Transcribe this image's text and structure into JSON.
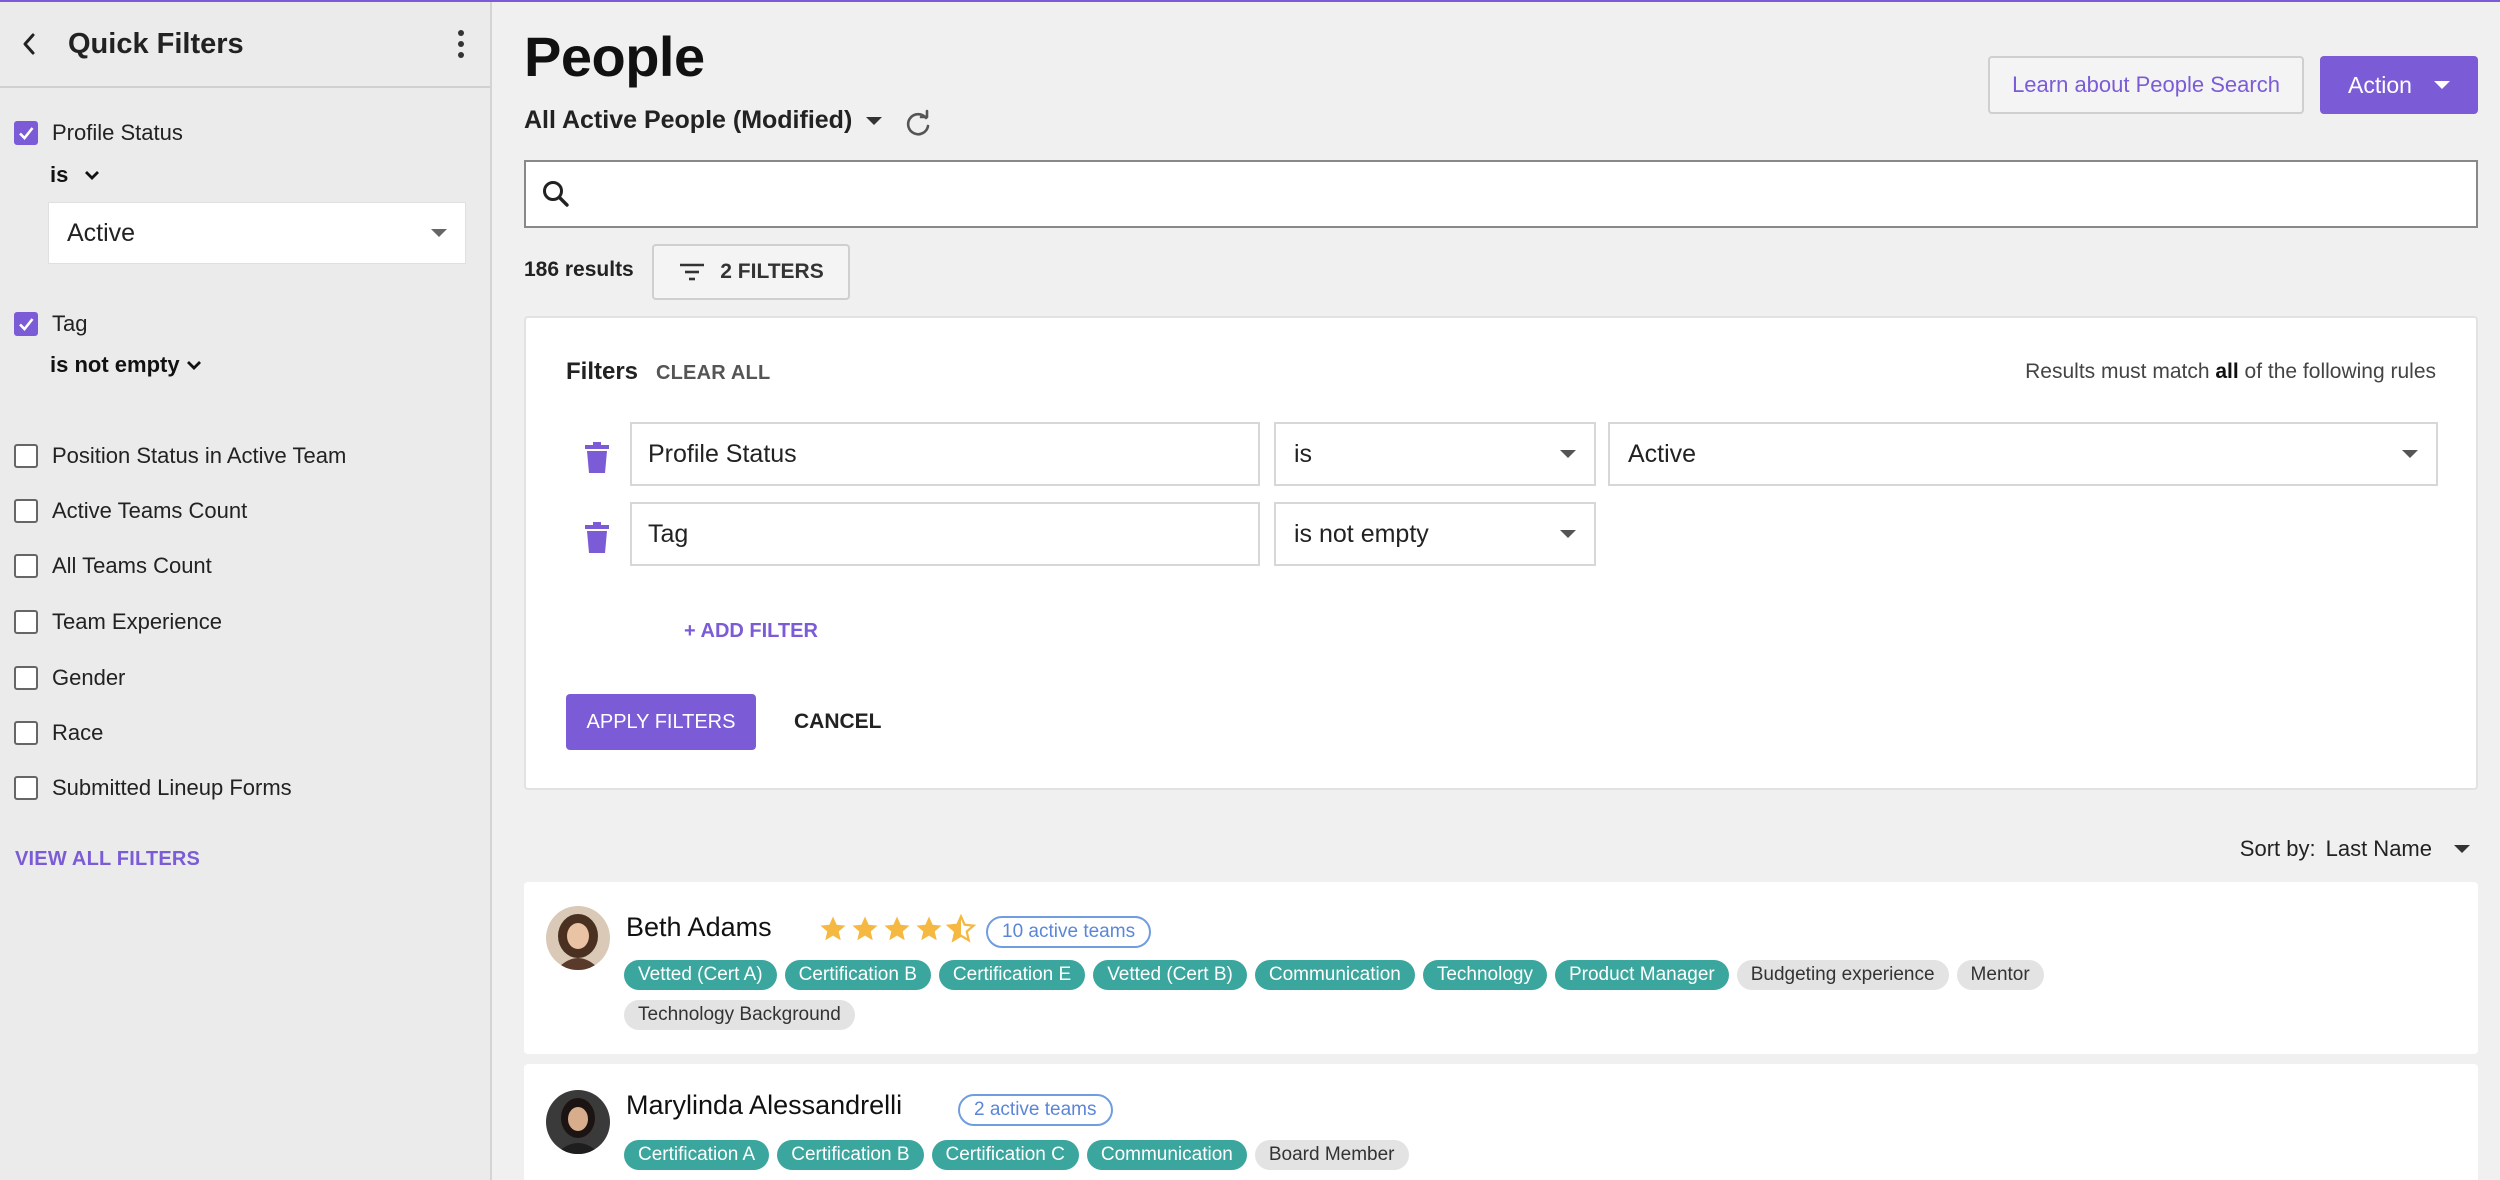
{
  "sidebar": {
    "title": "Quick Filters",
    "profile_status": {
      "label": "Profile Status",
      "checked": true,
      "operator": "is",
      "value": "Active"
    },
    "tag": {
      "label": "Tag",
      "checked": true,
      "operator": "is not empty"
    },
    "options": [
      {
        "label": "Position Status in Active Team",
        "checked": false
      },
      {
        "label": "Active Teams Count",
        "checked": false
      },
      {
        "label": "All Teams Count",
        "checked": false
      },
      {
        "label": "Team Experience",
        "checked": false
      },
      {
        "label": "Gender",
        "checked": false
      },
      {
        "label": "Race",
        "checked": false
      },
      {
        "label": "Submitted Lineup Forms",
        "checked": false
      }
    ],
    "view_all_label": "VIEW ALL FILTERS"
  },
  "header": {
    "title": "People",
    "view_name": "All Active People (Modified)",
    "learn_label": "Learn about People Search",
    "action_label": "Action"
  },
  "search": {
    "value": "",
    "placeholder": ""
  },
  "results": {
    "count_label": "186 results",
    "filters_label": "2 FILTERS"
  },
  "filter_panel": {
    "title": "Filters",
    "clear_all_label": "CLEAR ALL",
    "rule_prefix": "Results must match ",
    "rule_bold": "all",
    "rule_suffix": " of the following rules",
    "rows": [
      {
        "field": "Profile Status",
        "operator": "is",
        "value": "Active"
      },
      {
        "field": "Tag",
        "operator": "is not empty"
      }
    ],
    "add_filter_label": "+ ADD FILTER",
    "apply_label": "APPLY FILTERS",
    "cancel_label": "CANCEL"
  },
  "sort": {
    "prefix": "Sort by:",
    "value": "Last Name"
  },
  "people": [
    {
      "name": "Beth Adams",
      "rating": 4.5,
      "teams_label": "10 active teams",
      "tags": [
        {
          "label": "Vetted (Cert A)",
          "style": "teal"
        },
        {
          "label": "Certification B",
          "style": "teal"
        },
        {
          "label": "Certification E",
          "style": "teal"
        },
        {
          "label": "Vetted (Cert B)",
          "style": "teal"
        },
        {
          "label": "Communication",
          "style": "teal"
        },
        {
          "label": "Technology",
          "style": "teal"
        },
        {
          "label": "Product Manager",
          "style": "teal"
        },
        {
          "label": "Budgeting experience",
          "style": "grey"
        },
        {
          "label": "Mentor",
          "style": "grey"
        },
        {
          "label": "Technology Background",
          "style": "grey"
        }
      ]
    },
    {
      "name": "Marylinda Alessandrelli",
      "teams_label": "2 active teams",
      "tags": [
        {
          "label": "Certification A",
          "style": "teal"
        },
        {
          "label": "Certification B",
          "style": "teal"
        },
        {
          "label": "Certification C",
          "style": "teal"
        },
        {
          "label": "Communication",
          "style": "teal"
        },
        {
          "label": "Board Member",
          "style": "grey"
        }
      ]
    }
  ],
  "colors": {
    "accent": "#7b5cd6",
    "tag_teal": "#3aa69d",
    "star": "#f5b942",
    "badge_blue": "#5b86d8"
  }
}
